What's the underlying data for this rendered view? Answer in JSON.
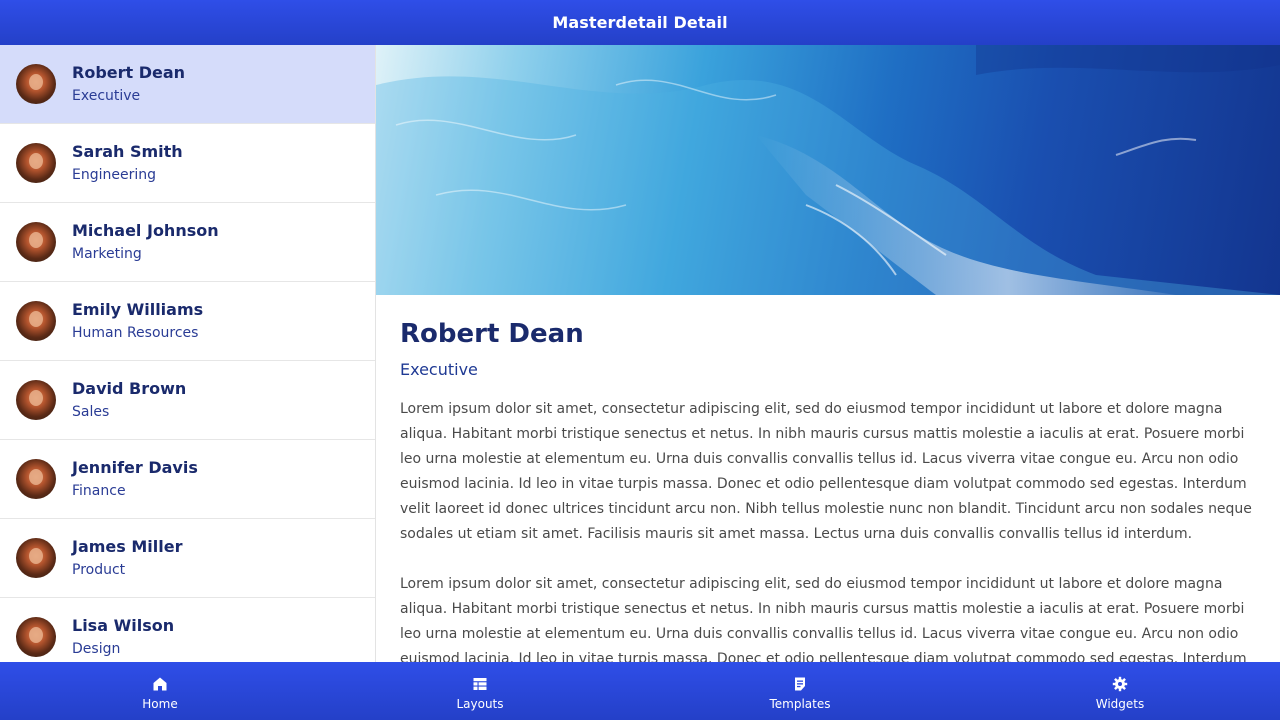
{
  "header": {
    "title": "Masterdetail Detail"
  },
  "master": {
    "items": [
      {
        "name": "Robert Dean",
        "department": "Executive"
      },
      {
        "name": "Sarah Smith",
        "department": "Engineering"
      },
      {
        "name": "Michael Johnson",
        "department": "Marketing"
      },
      {
        "name": "Emily Williams",
        "department": "Human Resources"
      },
      {
        "name": "David Brown",
        "department": "Sales"
      },
      {
        "name": "Jennifer Davis",
        "department": "Finance"
      },
      {
        "name": "James Miller",
        "department": "Product"
      },
      {
        "name": "Lisa Wilson",
        "department": "Design"
      }
    ]
  },
  "detail": {
    "name": "Robert Dean",
    "role": "Executive",
    "paragraphs": [
      "Lorem ipsum dolor sit amet, consectetur adipiscing elit, sed do eiusmod tempor incididunt ut labore et dolore magna aliqua. Habitant morbi tristique senectus et netus. In nibh mauris cursus mattis molestie a iaculis at erat. Posuere morbi leo urna molestie at elementum eu. Urna duis convallis convallis tellus id. Lacus viverra vitae congue eu. Arcu non odio euismod lacinia. Id leo in vitae turpis massa. Donec et odio pellentesque diam volutpat commodo sed egestas. Interdum velit laoreet id donec ultrices tincidunt arcu non. Nibh tellus molestie nunc non blandit. Tincidunt arcu non sodales neque sodales ut etiam sit amet. Facilisis mauris sit amet massa. Lectus urna duis convallis convallis tellus id interdum.",
      "Lorem ipsum dolor sit amet, consectetur adipiscing elit, sed do eiusmod tempor incididunt ut labore et dolore magna aliqua. Habitant morbi tristique senectus et netus. In nibh mauris cursus mattis molestie a iaculis at erat. Posuere morbi leo urna molestie at elementum eu. Urna duis convallis convallis tellus id. Lacus viverra vitae congue eu. Arcu non odio euismod lacinia. Id leo in vitae turpis massa. Donec et odio pellentesque diam volutpat commodo sed egestas. Interdum"
    ]
  },
  "bottom_nav": {
    "items": [
      {
        "label": "Home",
        "icon": "home-icon"
      },
      {
        "label": "Layouts",
        "icon": "table-icon"
      },
      {
        "label": "Templates",
        "icon": "document-icon"
      },
      {
        "label": "Widgets",
        "icon": "gear-icon"
      }
    ]
  },
  "colors": {
    "accent": "#2a47dc",
    "selected_row": "#d5dcfa",
    "heading": "#1a2a6c"
  }
}
